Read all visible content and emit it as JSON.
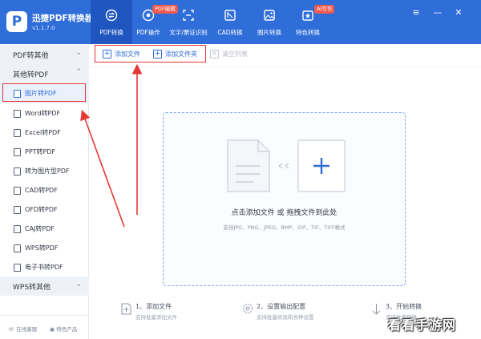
{
  "app": {
    "name": "迅捷PDF转换器",
    "version": "v1.1.7.0"
  },
  "nav": {
    "tabs": [
      {
        "label": "PDF转换",
        "icon": "pdf-convert-icon"
      },
      {
        "label": "PDF操作",
        "icon": "pdf-operate-icon",
        "badge": "PDF编辑"
      },
      {
        "label": "文字/票证识别",
        "icon": "ocr-icon"
      },
      {
        "label": "CAD转换",
        "icon": "cad-convert-icon"
      },
      {
        "label": "图片转换",
        "icon": "image-convert-icon"
      },
      {
        "label": "特色转换",
        "icon": "special-convert-icon",
        "badge": "AI写作"
      }
    ],
    "active": "PDF转换"
  },
  "window_controls": [
    "menu-icon",
    "minimize-icon",
    "close-icon"
  ],
  "sidebar": {
    "groups": [
      {
        "label": "PDF转其他",
        "state": "collapsed"
      },
      {
        "label": "其他转PDF",
        "state": "expanded"
      },
      {
        "label": "WPS转其他",
        "state": "collapsed"
      }
    ],
    "items": [
      {
        "label": "图片转PDF",
        "active": true
      },
      {
        "label": "Word转PDF"
      },
      {
        "label": "Excel转PDF"
      },
      {
        "label": "PPT转PDF"
      },
      {
        "label": "转为图片型PDF"
      },
      {
        "label": "CAD转PDF"
      },
      {
        "label": "OFD转PDF"
      },
      {
        "label": "CAJ转PDF"
      },
      {
        "label": "WPS转PDF"
      },
      {
        "label": "电子书转PDF"
      }
    ],
    "footer": {
      "online_service": "在线客服",
      "special_products": "特色产品"
    }
  },
  "toolbar": {
    "add_file": "添加文件",
    "add_folder": "添加文件夹",
    "clear_list": "清空列表"
  },
  "dropzone": {
    "text": "点击添加文件 或 拖拽文件到此处",
    "formats": "支持JPG、PNG、JPEG、BMP、GIF、TIF、TIFF格式"
  },
  "steps": [
    {
      "title": "1、添加文件",
      "desc": "支持批量添加文件"
    },
    {
      "title": "2、设置输出配置",
      "desc": "支持批量修改和各种设置"
    },
    {
      "title": "3、开始转换",
      "desc": "支持批量转换"
    }
  ],
  "watermark": "看看手游网",
  "colors": {
    "brand": "#2f6dd9",
    "highlight": "#e53935",
    "badge": "#f05b4f"
  }
}
